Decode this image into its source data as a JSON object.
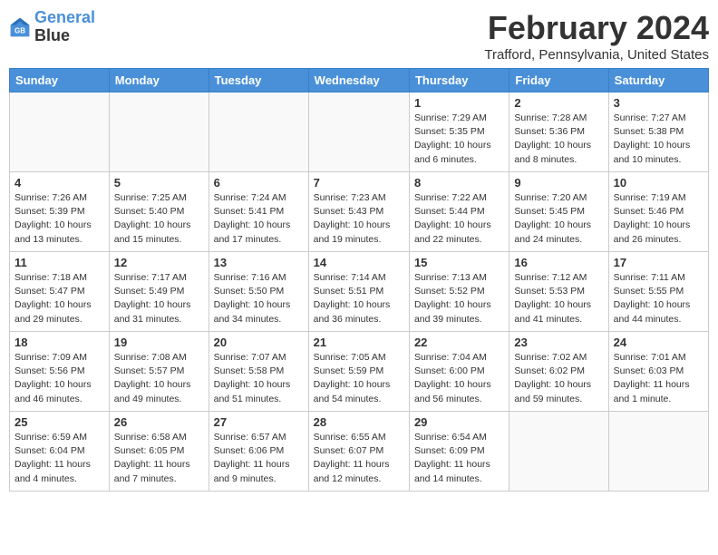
{
  "logo": {
    "line1": "General",
    "line2": "Blue"
  },
  "title": "February 2024",
  "location": "Trafford, Pennsylvania, United States",
  "days_of_week": [
    "Sunday",
    "Monday",
    "Tuesday",
    "Wednesday",
    "Thursday",
    "Friday",
    "Saturday"
  ],
  "weeks": [
    [
      {
        "num": "",
        "info": ""
      },
      {
        "num": "",
        "info": ""
      },
      {
        "num": "",
        "info": ""
      },
      {
        "num": "",
        "info": ""
      },
      {
        "num": "1",
        "info": "Sunrise: 7:29 AM\nSunset: 5:35 PM\nDaylight: 10 hours\nand 6 minutes."
      },
      {
        "num": "2",
        "info": "Sunrise: 7:28 AM\nSunset: 5:36 PM\nDaylight: 10 hours\nand 8 minutes."
      },
      {
        "num": "3",
        "info": "Sunrise: 7:27 AM\nSunset: 5:38 PM\nDaylight: 10 hours\nand 10 minutes."
      }
    ],
    [
      {
        "num": "4",
        "info": "Sunrise: 7:26 AM\nSunset: 5:39 PM\nDaylight: 10 hours\nand 13 minutes."
      },
      {
        "num": "5",
        "info": "Sunrise: 7:25 AM\nSunset: 5:40 PM\nDaylight: 10 hours\nand 15 minutes."
      },
      {
        "num": "6",
        "info": "Sunrise: 7:24 AM\nSunset: 5:41 PM\nDaylight: 10 hours\nand 17 minutes."
      },
      {
        "num": "7",
        "info": "Sunrise: 7:23 AM\nSunset: 5:43 PM\nDaylight: 10 hours\nand 19 minutes."
      },
      {
        "num": "8",
        "info": "Sunrise: 7:22 AM\nSunset: 5:44 PM\nDaylight: 10 hours\nand 22 minutes."
      },
      {
        "num": "9",
        "info": "Sunrise: 7:20 AM\nSunset: 5:45 PM\nDaylight: 10 hours\nand 24 minutes."
      },
      {
        "num": "10",
        "info": "Sunrise: 7:19 AM\nSunset: 5:46 PM\nDaylight: 10 hours\nand 26 minutes."
      }
    ],
    [
      {
        "num": "11",
        "info": "Sunrise: 7:18 AM\nSunset: 5:47 PM\nDaylight: 10 hours\nand 29 minutes."
      },
      {
        "num": "12",
        "info": "Sunrise: 7:17 AM\nSunset: 5:49 PM\nDaylight: 10 hours\nand 31 minutes."
      },
      {
        "num": "13",
        "info": "Sunrise: 7:16 AM\nSunset: 5:50 PM\nDaylight: 10 hours\nand 34 minutes."
      },
      {
        "num": "14",
        "info": "Sunrise: 7:14 AM\nSunset: 5:51 PM\nDaylight: 10 hours\nand 36 minutes."
      },
      {
        "num": "15",
        "info": "Sunrise: 7:13 AM\nSunset: 5:52 PM\nDaylight: 10 hours\nand 39 minutes."
      },
      {
        "num": "16",
        "info": "Sunrise: 7:12 AM\nSunset: 5:53 PM\nDaylight: 10 hours\nand 41 minutes."
      },
      {
        "num": "17",
        "info": "Sunrise: 7:11 AM\nSunset: 5:55 PM\nDaylight: 10 hours\nand 44 minutes."
      }
    ],
    [
      {
        "num": "18",
        "info": "Sunrise: 7:09 AM\nSunset: 5:56 PM\nDaylight: 10 hours\nand 46 minutes."
      },
      {
        "num": "19",
        "info": "Sunrise: 7:08 AM\nSunset: 5:57 PM\nDaylight: 10 hours\nand 49 minutes."
      },
      {
        "num": "20",
        "info": "Sunrise: 7:07 AM\nSunset: 5:58 PM\nDaylight: 10 hours\nand 51 minutes."
      },
      {
        "num": "21",
        "info": "Sunrise: 7:05 AM\nSunset: 5:59 PM\nDaylight: 10 hours\nand 54 minutes."
      },
      {
        "num": "22",
        "info": "Sunrise: 7:04 AM\nSunset: 6:00 PM\nDaylight: 10 hours\nand 56 minutes."
      },
      {
        "num": "23",
        "info": "Sunrise: 7:02 AM\nSunset: 6:02 PM\nDaylight: 10 hours\nand 59 minutes."
      },
      {
        "num": "24",
        "info": "Sunrise: 7:01 AM\nSunset: 6:03 PM\nDaylight: 11 hours\nand 1 minute."
      }
    ],
    [
      {
        "num": "25",
        "info": "Sunrise: 6:59 AM\nSunset: 6:04 PM\nDaylight: 11 hours\nand 4 minutes."
      },
      {
        "num": "26",
        "info": "Sunrise: 6:58 AM\nSunset: 6:05 PM\nDaylight: 11 hours\nand 7 minutes."
      },
      {
        "num": "27",
        "info": "Sunrise: 6:57 AM\nSunset: 6:06 PM\nDaylight: 11 hours\nand 9 minutes."
      },
      {
        "num": "28",
        "info": "Sunrise: 6:55 AM\nSunset: 6:07 PM\nDaylight: 11 hours\nand 12 minutes."
      },
      {
        "num": "29",
        "info": "Sunrise: 6:54 AM\nSunset: 6:09 PM\nDaylight: 11 hours\nand 14 minutes."
      },
      {
        "num": "",
        "info": ""
      },
      {
        "num": "",
        "info": ""
      }
    ]
  ]
}
